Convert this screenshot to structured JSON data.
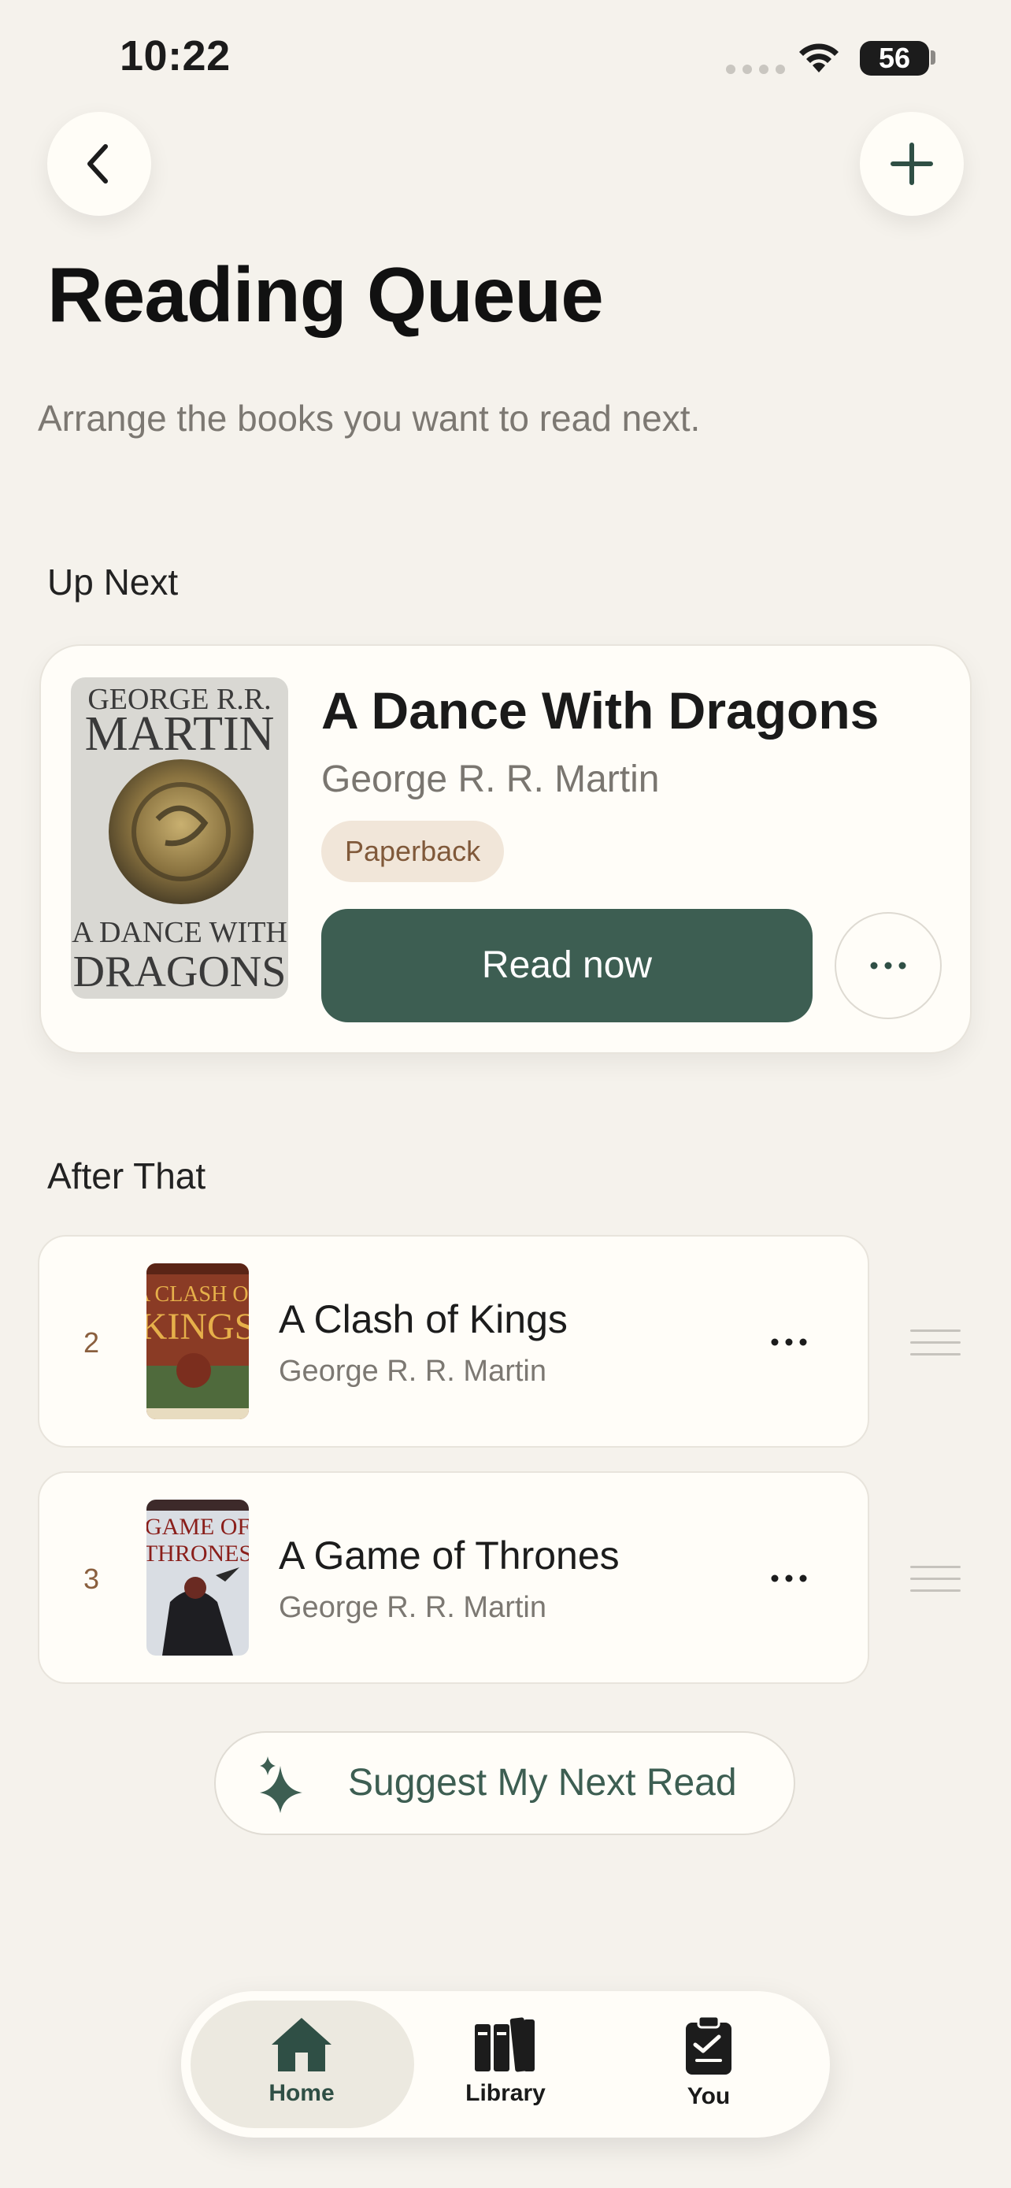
{
  "status_bar": {
    "time": "10:22",
    "battery": "56"
  },
  "nav": {
    "back_icon": "chevron-left-icon",
    "add_icon": "plus-icon"
  },
  "header": {
    "title": "Reading Queue",
    "subtitle": "Arrange the books you want to read next."
  },
  "up_next": {
    "section_label": "Up Next",
    "title": "A Dance With Dragons",
    "author": "George R. R. Martin",
    "format": "Paperback",
    "primary_action": "Read now",
    "cover_text": {
      "top": "GEORGE R.R.",
      "mid": "MARTIN",
      "bottom1": "A DANCE WITH",
      "bottom2": "DRAGONS"
    }
  },
  "after_that": {
    "section_label": "After That",
    "items": [
      {
        "position": "2",
        "title": "A Clash of Kings",
        "author": "George R. R. Martin",
        "cover_line1": "A CLASH OF",
        "cover_line2": "KINGS"
      },
      {
        "position": "3",
        "title": "A Game of Thrones",
        "author": "George R. R. Martin",
        "cover_line1": "GAME OF",
        "cover_line2": "THRONES"
      }
    ]
  },
  "suggest": {
    "label": "Suggest My Next Read",
    "icon": "sparkle-icon"
  },
  "tabs": [
    {
      "label": "Home",
      "icon": "home-icon",
      "selected": true
    },
    {
      "label": "Library",
      "icon": "books-icon",
      "selected": false
    },
    {
      "label": "You",
      "icon": "clipboard-icon",
      "selected": false
    }
  ],
  "colors": {
    "accent": "#3d5e52",
    "background": "#f5f2ec",
    "pill_bg": "#f1e6d9",
    "pill_text": "#80593a"
  }
}
